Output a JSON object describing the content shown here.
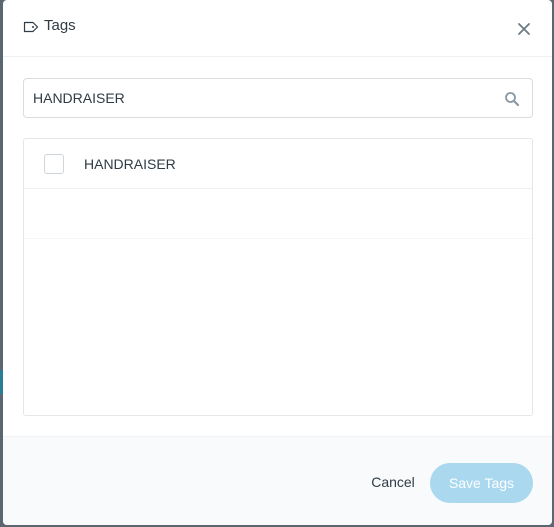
{
  "modal": {
    "title": "Tags",
    "title_icon": "tag-icon",
    "close_icon": "close-icon"
  },
  "search": {
    "value": "HANDRAISER",
    "placeholder": "",
    "icon": "search-icon"
  },
  "tag_list": {
    "items": [
      {
        "label": "HANDRAISER",
        "checked": false
      }
    ]
  },
  "footer": {
    "cancel_label": "Cancel",
    "save_label": "Save Tags",
    "save_disabled": true
  },
  "colors": {
    "accent_disabled": "#a9d8ef",
    "text": "#2f3b45",
    "backdrop": "#5b6770"
  }
}
